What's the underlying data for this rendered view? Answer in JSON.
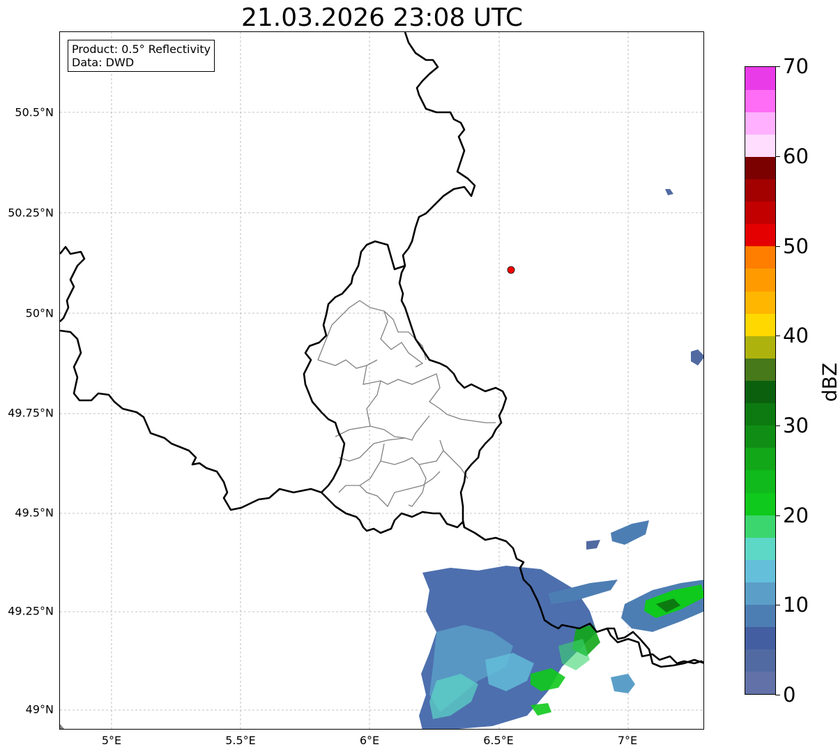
{
  "title": "21.03.2026 23:08 UTC",
  "info_box": {
    "product": "Product: 0.5° Reflectivity",
    "data": "Data: DWD"
  },
  "map": {
    "lon_range": [
      4.8,
      7.3
    ],
    "lat_range": [
      48.95,
      50.7
    ],
    "lat_ticks": [
      "50.5°N",
      "50.25°N",
      "50°N",
      "49.75°N",
      "49.5°N",
      "49.25°N",
      "49°N"
    ],
    "lon_ticks": [
      "5°E",
      "5.5°E",
      "6°E",
      "6.5°E",
      "7°E"
    ],
    "gridlines": true,
    "radar_site_marker": {
      "lon": 6.55,
      "lat": 50.11,
      "color": "#ff0000"
    }
  },
  "colorbar": {
    "label": "dBZ",
    "range": [
      0,
      70
    ],
    "tick_labels": [
      "0",
      "10",
      "20",
      "30",
      "40",
      "50",
      "60",
      "70"
    ],
    "colors": [
      "#6272a8",
      "#516aa2",
      "#435ea1",
      "#4d7eb3",
      "#5b9fc8",
      "#64bfdb",
      "#5dd7c6",
      "#3cd66e",
      "#0fc91c",
      "#10b91c",
      "#12a718",
      "#0f8d14",
      "#0c7a10",
      "#0b600e",
      "#47781a",
      "#aeb20c",
      "#ffd800",
      "#ffb600",
      "#ff9b00",
      "#ff7e00",
      "#e40000",
      "#c30000",
      "#a30000",
      "#7b0000",
      "#ffddff",
      "#ffb1ff",
      "#ff6cf6",
      "#e93ce8"
    ]
  }
}
